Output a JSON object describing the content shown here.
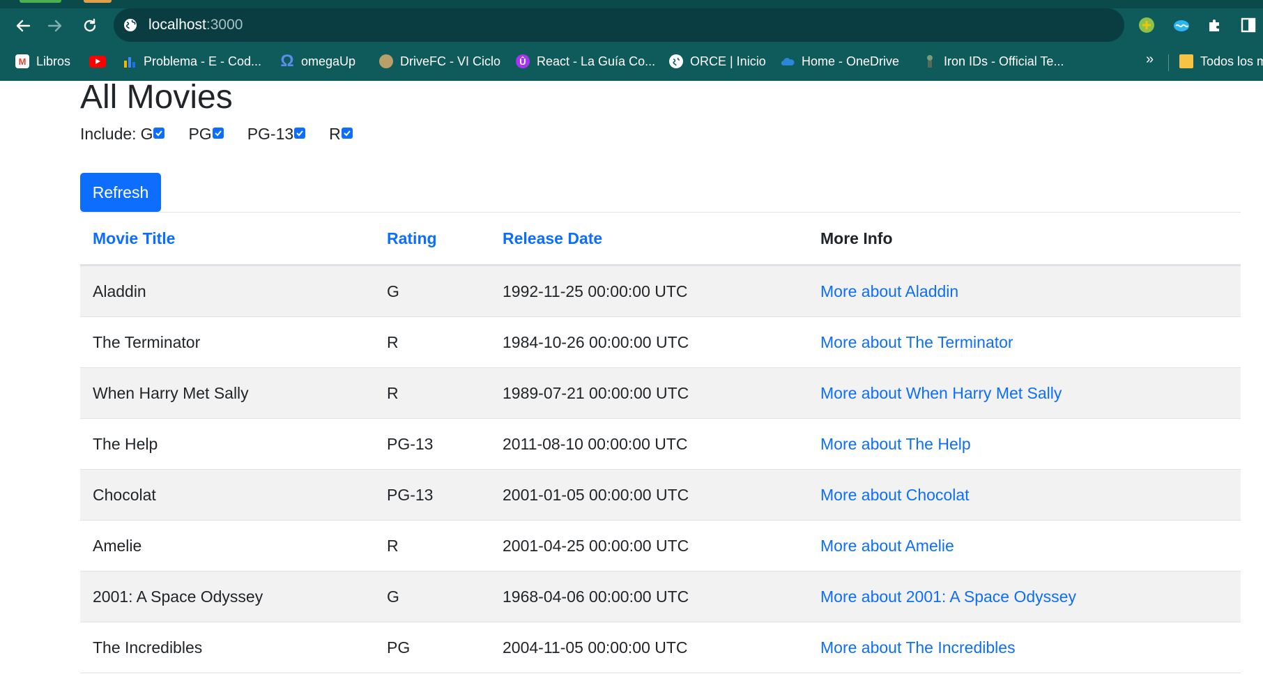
{
  "browser": {
    "url_host": "localhost",
    "url_port": ":3000",
    "bookmarks": [
      {
        "label": "Libros",
        "icon": "gmail-icon",
        "color": "#ea4335"
      },
      {
        "label": "",
        "icon": "youtube-icon",
        "color": "#ff0000"
      },
      {
        "label": "Problema - E - Cod...",
        "icon": "bar-chart-icon",
        "color": "#1a73e8"
      },
      {
        "label": "omegaUp",
        "icon": "omega-icon",
        "color": "#5b8def"
      },
      {
        "label": "DriveFC - VI Ciclo",
        "icon": "seal-icon",
        "color": "#b8a06a"
      },
      {
        "label": "React - La Guía Co...",
        "icon": "udemy-icon",
        "color": "#a435f0"
      },
      {
        "label": "ORCE | Inicio",
        "icon": "globe-icon",
        "color": "#ffffff"
      },
      {
        "label": "Home - OneDrive",
        "icon": "cloud-icon",
        "color": "#2b88d8"
      },
      {
        "label": "Iron IDs - Official Te...",
        "icon": "figure-icon",
        "color": "#8aa"
      },
      {
        "label": "Todos los m",
        "icon": "folder-icon",
        "color": "#f6c344"
      }
    ],
    "more_label": "»"
  },
  "page": {
    "title": "All Movies",
    "include_label": "Include:",
    "ratings": [
      {
        "label": "G",
        "checked": true
      },
      {
        "label": "PG",
        "checked": true
      },
      {
        "label": "PG-13",
        "checked": true
      },
      {
        "label": "R",
        "checked": true
      }
    ],
    "refresh_label": "Refresh",
    "columns": [
      "Movie Title",
      "Rating",
      "Release Date",
      "More Info"
    ],
    "movies": [
      {
        "title": "Aladdin",
        "rating": "G",
        "release_date": "1992-11-25 00:00:00 UTC",
        "link": "More about Aladdin"
      },
      {
        "title": "The Terminator",
        "rating": "R",
        "release_date": "1984-10-26 00:00:00 UTC",
        "link": "More about The Terminator"
      },
      {
        "title": "When Harry Met Sally",
        "rating": "R",
        "release_date": "1989-07-21 00:00:00 UTC",
        "link": "More about When Harry Met Sally"
      },
      {
        "title": "The Help",
        "rating": "PG-13",
        "release_date": "2011-08-10 00:00:00 UTC",
        "link": "More about The Help"
      },
      {
        "title": "Chocolat",
        "rating": "PG-13",
        "release_date": "2001-01-05 00:00:00 UTC",
        "link": "More about Chocolat"
      },
      {
        "title": "Amelie",
        "rating": "R",
        "release_date": "2001-04-25 00:00:00 UTC",
        "link": "More about Amelie"
      },
      {
        "title": "2001: A Space Odyssey",
        "rating": "G",
        "release_date": "1968-04-06 00:00:00 UTC",
        "link": "More about 2001: A Space Odyssey"
      },
      {
        "title": "The Incredibles",
        "rating": "PG",
        "release_date": "2004-11-05 00:00:00 UTC",
        "link": "More about The Incredibles"
      }
    ]
  },
  "colors": {
    "chrome_bg": "#0f5a5a",
    "link_blue": "#0d6efd",
    "stripe": "#f2f2f2"
  }
}
